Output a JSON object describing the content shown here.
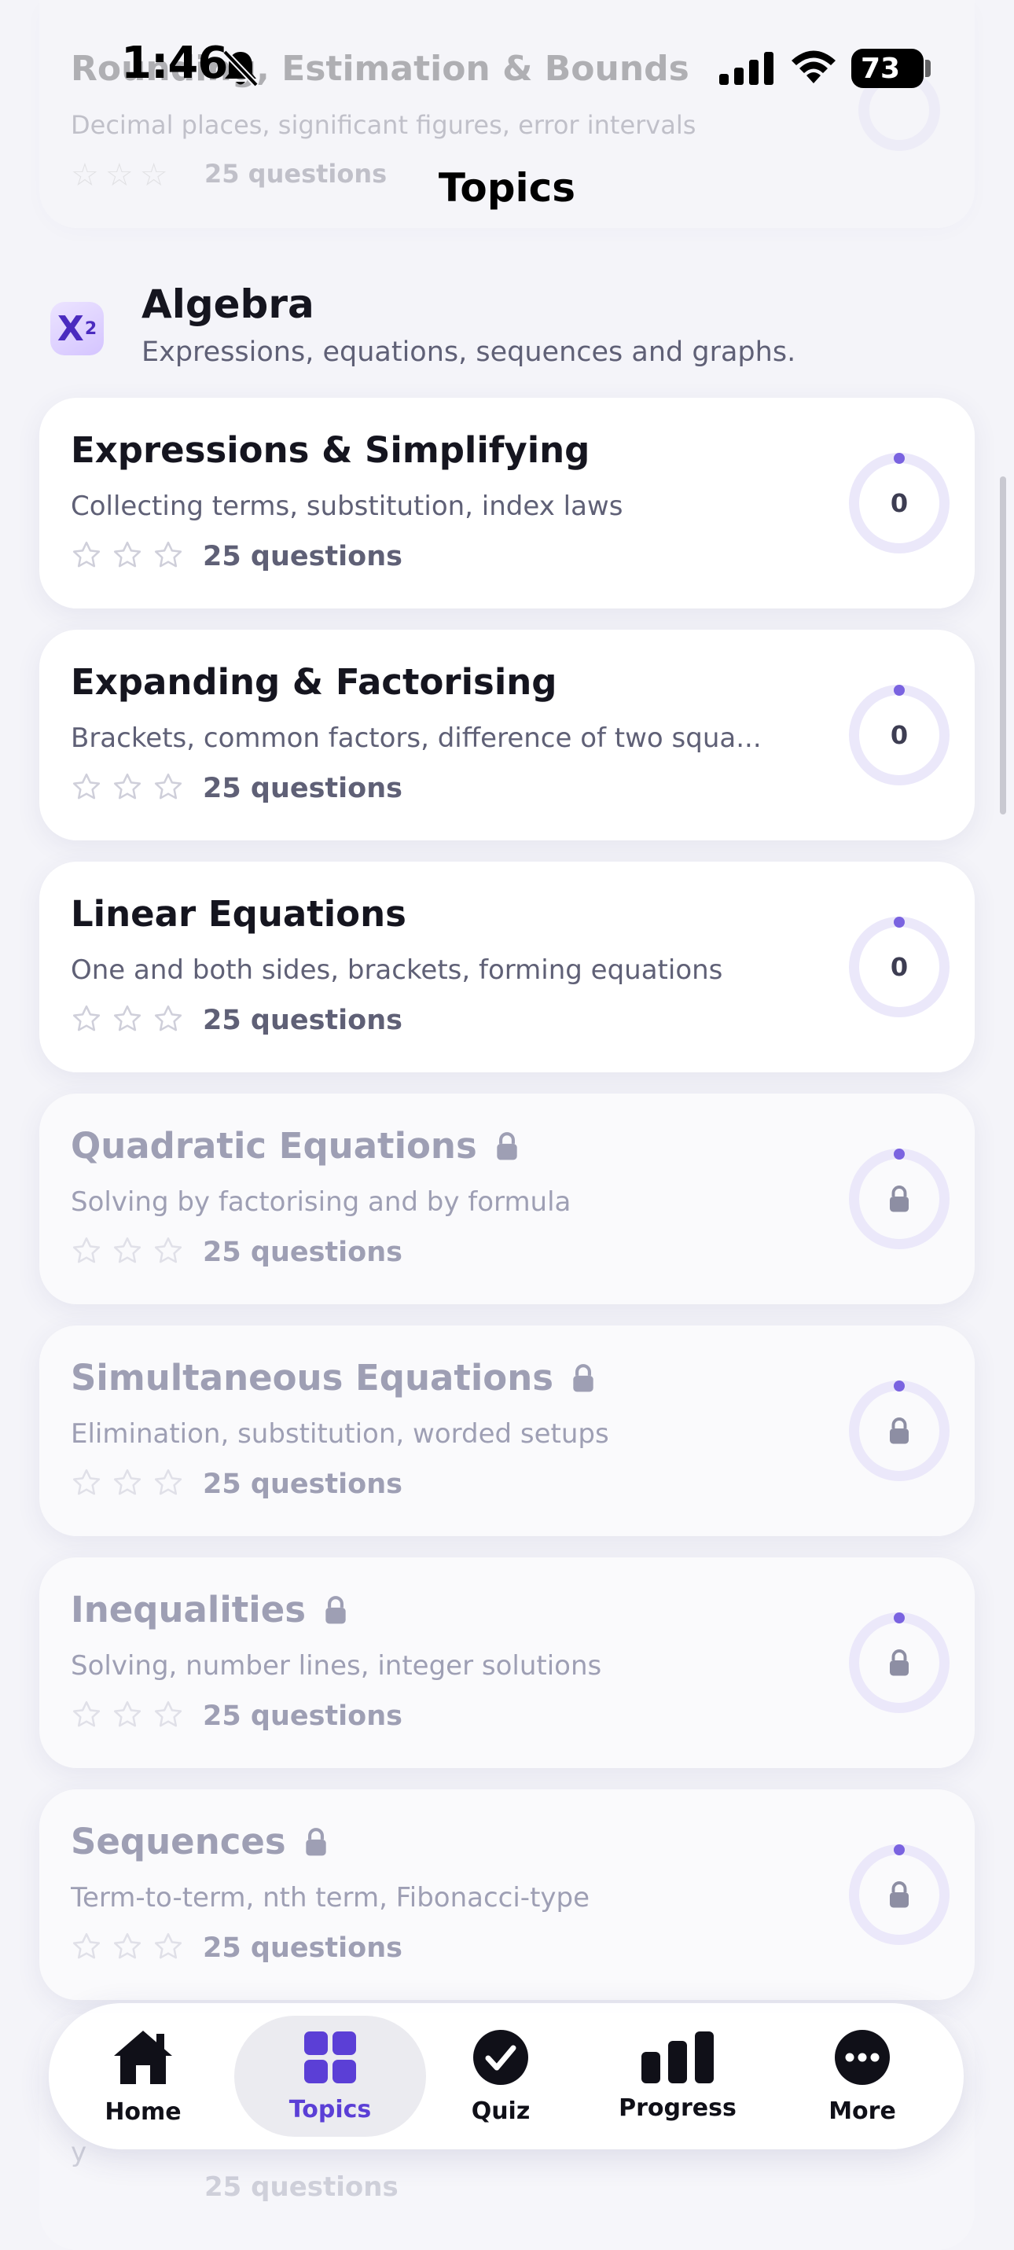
{
  "status_bar": {
    "time": "1:46",
    "battery": "73"
  },
  "nav": {
    "title": "Topics"
  },
  "previous_card": {
    "title": "Rounding, Estimation & Bounds",
    "description": "Decimal places, significant figures, error intervals",
    "questions": "25 questions",
    "progress": "0"
  },
  "section": {
    "icon_text": "X",
    "icon_sup": "2",
    "title": "Algebra",
    "subtitle": "Expressions, equations, sequences and graphs."
  },
  "topics": [
    {
      "title": "Expressions & Simplifying",
      "description": "Collecting terms, substitution, index laws",
      "questions": "25 questions",
      "progress": "0",
      "locked": false,
      "stars": 0
    },
    {
      "title": "Expanding & Factorising",
      "description": "Brackets, common factors, difference of two squa...",
      "questions": "25 questions",
      "progress": "0",
      "locked": false,
      "stars": 0
    },
    {
      "title": "Linear Equations",
      "description": "One and both sides, brackets, forming equations",
      "questions": "25 questions",
      "progress": "0",
      "locked": false,
      "stars": 0
    },
    {
      "title": "Quadratic Equations",
      "description": "Solving by factorising and by formula",
      "questions": "25 questions",
      "locked": true,
      "stars": 0
    },
    {
      "title": "Simultaneous Equations",
      "description": "Elimination, substitution, worded setups",
      "questions": "25 questions",
      "locked": true,
      "stars": 0
    },
    {
      "title": "Inequalities",
      "description": "Solving, number lines, integer solutions",
      "questions": "25 questions",
      "locked": true,
      "stars": 0
    },
    {
      "title": "Sequences",
      "description": "Term-to-term, nth term, Fibonacci-type",
      "questions": "25 questions",
      "locked": true,
      "stars": 0
    }
  ],
  "next_card": {
    "questions": "25 questions",
    "partial_desc": "y"
  },
  "tabbar": {
    "home": "Home",
    "topics": "Topics",
    "quiz": "Quiz",
    "progress": "Progress",
    "more": "More",
    "active": "topics",
    "accent_color": "#5b3fd6"
  }
}
